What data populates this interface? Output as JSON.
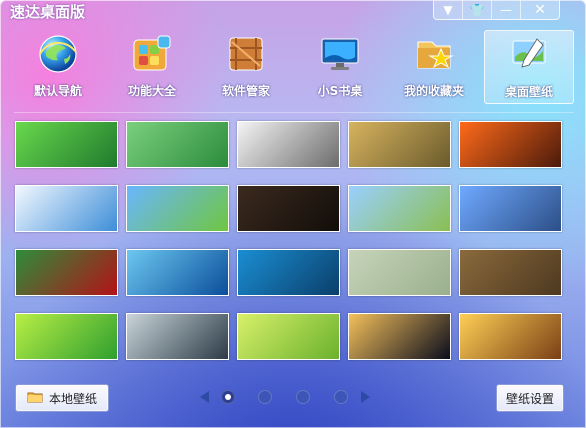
{
  "window": {
    "title": "速达桌面版",
    "accent": "#2f47a8"
  },
  "controls": [
    {
      "icon": "dropdown-icon",
      "glyph": "▼"
    },
    {
      "icon": "shirt-skin-icon",
      "glyph": "👕"
    },
    {
      "icon": "minimize-icon",
      "glyph": "—"
    },
    {
      "icon": "close-icon",
      "glyph": "✕"
    }
  ],
  "nav": {
    "items": [
      {
        "label": "默认导航",
        "icon": "globe-icon"
      },
      {
        "label": "功能大全",
        "icon": "apps-icon"
      },
      {
        "label": "软件管家",
        "icon": "box-icon"
      },
      {
        "label": "小S书桌",
        "icon": "monitor-icon"
      },
      {
        "label": "我的收藏夹",
        "icon": "favorites-folder-icon"
      },
      {
        "label": "桌面壁纸",
        "icon": "wallpaper-icon",
        "active": true
      }
    ]
  },
  "wallpapers": [
    {
      "name": "green-parrot",
      "colors": [
        "#69d84d",
        "#1f7a2d"
      ]
    },
    {
      "name": "bamboo",
      "colors": [
        "#7bd07d",
        "#2b8c3c"
      ]
    },
    {
      "name": "glass-bw",
      "colors": [
        "#f4f4f4",
        "#6c6c6c"
      ]
    },
    {
      "name": "tea-cup",
      "colors": [
        "#d7b35f",
        "#6a5b2c"
      ]
    },
    {
      "name": "fire-abstract",
      "colors": [
        "#ff6a1a",
        "#4b1a0b"
      ]
    },
    {
      "name": "clouds-blue",
      "colors": [
        "#f2f8ff",
        "#3d8ed8"
      ]
    },
    {
      "name": "meadow-sky",
      "colors": [
        "#69b6ff",
        "#6fc63f"
      ]
    },
    {
      "name": "clock-dark",
      "colors": [
        "#3b2a1f",
        "#120d09"
      ]
    },
    {
      "name": "tree-road",
      "colors": [
        "#9ad0ff",
        "#8abf52"
      ]
    },
    {
      "name": "car-speed",
      "colors": [
        "#6fa9ff",
        "#2c4f87"
      ]
    },
    {
      "name": "red-flowers",
      "colors": [
        "#2d8d3a",
        "#b31217"
      ]
    },
    {
      "name": "water-deep",
      "colors": [
        "#6cc8f0",
        "#0b4e9b"
      ]
    },
    {
      "name": "lake-reflection",
      "colors": [
        "#1a8ed2",
        "#0b3f6b"
      ]
    },
    {
      "name": "icons-board",
      "colors": [
        "#c6d4b9",
        "#9ab08d"
      ]
    },
    {
      "name": "wood-wall",
      "colors": [
        "#8a6a3c",
        "#4d3820"
      ]
    },
    {
      "name": "windows-green",
      "colors": [
        "#b8ee45",
        "#2f9f2f"
      ]
    },
    {
      "name": "broken-glass",
      "colors": [
        "#c8d4d9",
        "#2c3b47"
      ]
    },
    {
      "name": "lime-splash",
      "colors": [
        "#d8f06a",
        "#6ab12d"
      ]
    },
    {
      "name": "galaxy",
      "colors": [
        "#f4c05b",
        "#0b0d1d"
      ]
    },
    {
      "name": "golden-sparkle",
      "colors": [
        "#ffcf55",
        "#7a3f16"
      ]
    }
  ],
  "footer": {
    "local_wallpaper_label": "本地壁纸",
    "wallpaper_settings_label": "壁纸设置",
    "pager": {
      "pages": 4,
      "current": 1
    }
  }
}
